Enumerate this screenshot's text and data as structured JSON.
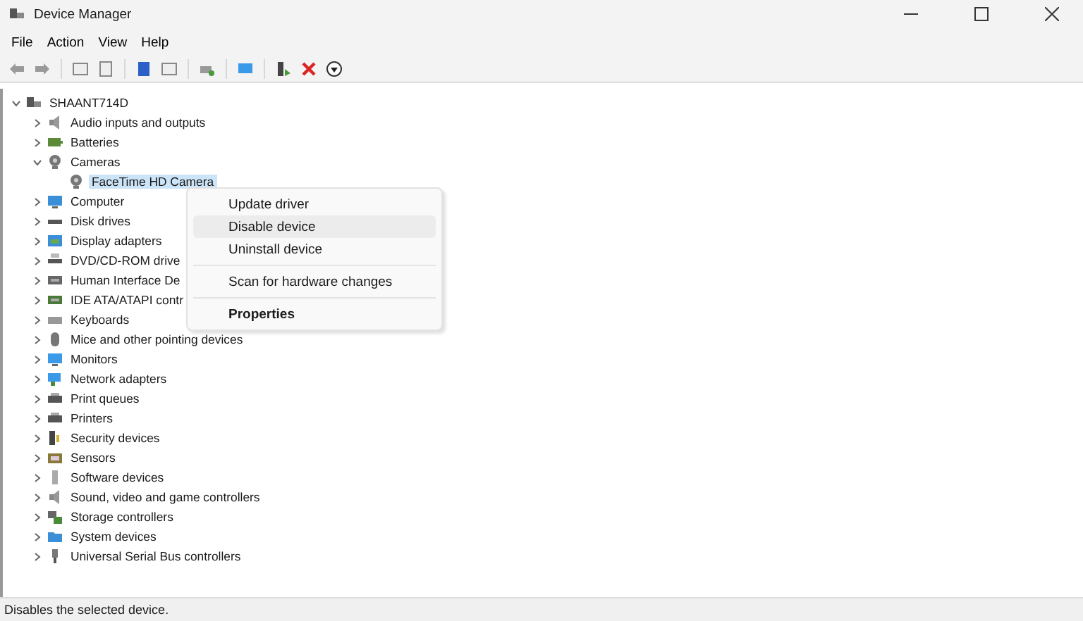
{
  "window": {
    "title": "Device Manager"
  },
  "menu_bar": [
    "File",
    "Action",
    "View",
    "Help"
  ],
  "tree": [
    {
      "label": "SHAANT714D",
      "expanded": true,
      "selected": false,
      "children": [
        {
          "label": "Audio inputs and outputs",
          "expanded": false,
          "selected": false
        },
        {
          "label": "Batteries",
          "expanded": false,
          "selected": false
        },
        {
          "label": "Cameras",
          "expanded": true,
          "selected": false,
          "children": [
            {
              "label": "FaceTime HD Camera",
              "selected": true
            }
          ]
        },
        {
          "label": "Computer",
          "expanded": false,
          "selected": false
        },
        {
          "label": "Disk drives",
          "expanded": false,
          "selected": false
        },
        {
          "label": "Display adapters",
          "expanded": false,
          "selected": false
        },
        {
          "label": "DVD/CD-ROM drive",
          "expanded": false,
          "selected": false
        },
        {
          "label": "Human Interface De",
          "expanded": false,
          "selected": false
        },
        {
          "label": "IDE ATA/ATAPI contr",
          "expanded": false,
          "selected": false
        },
        {
          "label": "Keyboards",
          "expanded": false,
          "selected": false
        },
        {
          "label": "Mice and other pointing devices",
          "expanded": false,
          "selected": false
        },
        {
          "label": "Monitors",
          "expanded": false,
          "selected": false
        },
        {
          "label": "Network adapters",
          "expanded": false,
          "selected": false
        },
        {
          "label": "Print queues",
          "expanded": false,
          "selected": false
        },
        {
          "label": "Printers",
          "expanded": false,
          "selected": false
        },
        {
          "label": "Security devices",
          "expanded": false,
          "selected": false
        },
        {
          "label": "Sensors",
          "expanded": false,
          "selected": false
        },
        {
          "label": "Software devices",
          "expanded": false,
          "selected": false
        },
        {
          "label": "Sound, video and game controllers",
          "expanded": false,
          "selected": false
        },
        {
          "label": "Storage controllers",
          "expanded": false,
          "selected": false
        },
        {
          "label": "System devices",
          "expanded": false,
          "selected": false
        },
        {
          "label": "Universal Serial Bus controllers",
          "expanded": false,
          "selected": false
        }
      ]
    }
  ],
  "context_menu": [
    {
      "kind": "item",
      "label": "Update driver",
      "selected": false
    },
    {
      "kind": "item",
      "label": "Disable device",
      "selected": true
    },
    {
      "kind": "item",
      "label": "Uninstall device",
      "selected": false
    },
    {
      "kind": "separator"
    },
    {
      "kind": "item",
      "label": "Scan for hardware changes",
      "selected": false
    },
    {
      "kind": "separator"
    },
    {
      "kind": "default",
      "label": "Properties",
      "selected": false
    }
  ],
  "status_bar": "Disables the selected device."
}
